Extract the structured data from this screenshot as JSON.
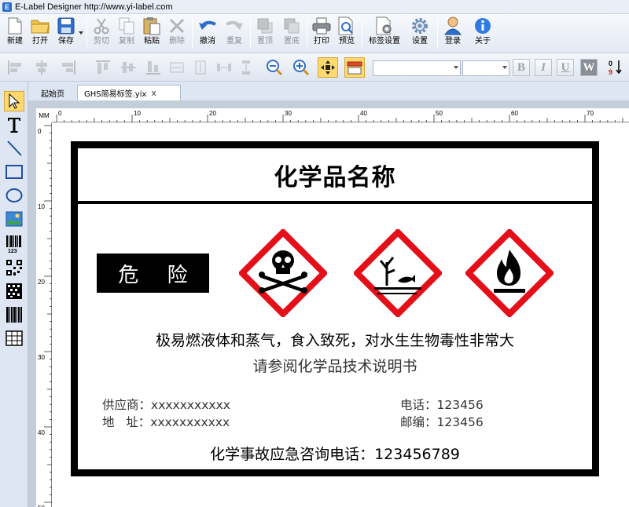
{
  "window": {
    "title": "E-Label Designer http://www.yi-label.com"
  },
  "toolbar": {
    "new": "新建",
    "open": "打开",
    "save": "保存",
    "cut": "剪切",
    "copy": "复制",
    "paste": "粘贴",
    "delete": "删除",
    "undo": "撤消",
    "redo": "重复",
    "to_top": "置顶",
    "to_bottom": "置底",
    "print": "打印",
    "preview": "预览",
    "label_settings": "标签设置",
    "settings": "设置",
    "login": "登录",
    "about": "关于"
  },
  "format_toolbar": {
    "font_name": "",
    "font_size": "",
    "bold": "B",
    "italic": "I",
    "underline": "U",
    "wrap": "W",
    "sort_icon_text": "0 9"
  },
  "tabs": [
    {
      "label": "起始页"
    },
    {
      "label": "GHS简易标签.yix",
      "close": "x"
    }
  ],
  "ruler": {
    "unit": "MM",
    "top_ticks": [
      "0",
      "10",
      "20",
      "30",
      "40",
      "50",
      "60",
      "70"
    ],
    "left_ticks": [
      "0",
      "10",
      "20",
      "30",
      "40",
      "50"
    ]
  },
  "label": {
    "title": "化学品名称",
    "signal_word": "危 险",
    "hazard_statement": "极易燃液体和蒸气，食入致死，对水生生物毒性非常大",
    "reference": "请参阅化学品技术说明书",
    "supplier_label": "供应商：",
    "supplier_value": "xxxxxxxxxxx",
    "address_label": "地   址：",
    "address_value": "xxxxxxxxxxx",
    "phone_label": "电话：",
    "phone_value": "123456",
    "postcode_label": "邮编：",
    "postcode_value": "123456",
    "emergency": "化学事故应急咨询电话：123456789",
    "pictograms": [
      "skull-crossbones",
      "environment",
      "flame"
    ]
  },
  "colors": {
    "pictogram_border": "#e3101a",
    "accent": "#ffd86e"
  }
}
